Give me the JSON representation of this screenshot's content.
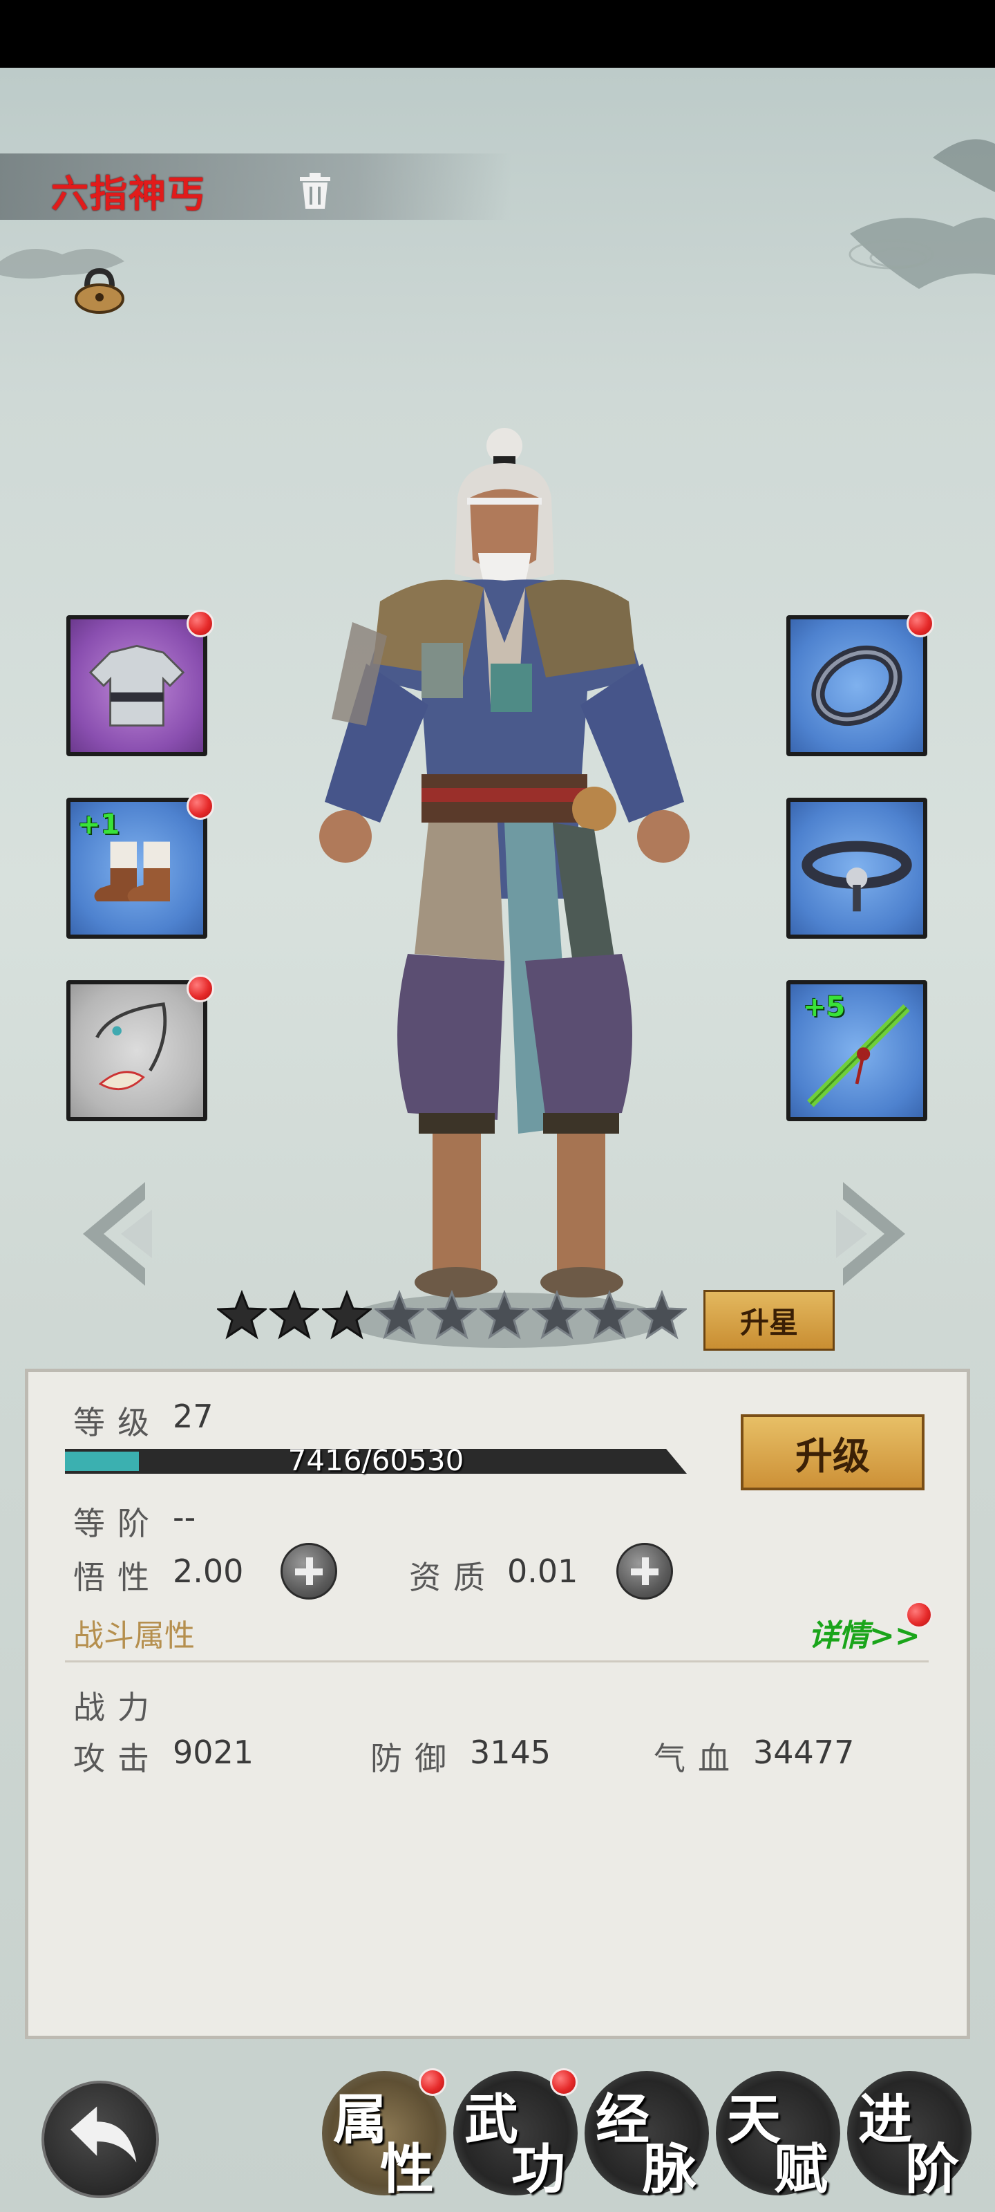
{
  "character": {
    "name": "六指神丐"
  },
  "equipment": {
    "left": [
      {
        "item": "robe",
        "has_notice": true,
        "enhance": ""
      },
      {
        "item": "boots",
        "has_notice": true,
        "enhance": "+1"
      },
      {
        "item": "fang-necklace",
        "has_notice": true,
        "enhance": ""
      }
    ],
    "right": [
      {
        "item": "ring",
        "has_notice": true,
        "enhance": ""
      },
      {
        "item": "belt",
        "has_notice": false,
        "enhance": ""
      },
      {
        "item": "bamboo-staff",
        "has_notice": false,
        "enhance": "+5"
      }
    ]
  },
  "stars": {
    "total": 9,
    "filled": 3
  },
  "star_up_label": "升星",
  "stats": {
    "level_label": "等级",
    "level_value": "27",
    "xp_text": "7416/60530",
    "xp_current": 7416,
    "xp_max": 60530,
    "level_up_label": "升级",
    "rank_label": "等阶",
    "rank_value": "--",
    "insight_label": "悟性",
    "insight_value": "2.00",
    "aptitude_label": "资质",
    "aptitude_value": "0.01",
    "battle_section_title": "战斗属性",
    "details_link": "详情>>",
    "power_label": "战力",
    "attack_label": "攻击",
    "attack_value": "9021",
    "defense_label": "防御",
    "defense_value": "3145",
    "hp_label": "气血",
    "hp_value": "34477"
  },
  "tabs": [
    {
      "c1": "属",
      "c2": "性",
      "active": true,
      "has_notice": true
    },
    {
      "c1": "武",
      "c2": "功",
      "active": false,
      "has_notice": true
    },
    {
      "c1": "经",
      "c2": "脉",
      "active": false,
      "has_notice": false
    },
    {
      "c1": "天",
      "c2": "赋",
      "active": false,
      "has_notice": false
    },
    {
      "c1": "进",
      "c2": "阶",
      "active": false,
      "has_notice": false
    }
  ],
  "colors": {
    "name_red": "#e11b1b",
    "xp_fill": "#3bb0b0",
    "enhance_green": "#39e239",
    "details_green": "#1aa51a"
  },
  "icons": [
    "trash-icon",
    "lock-icon",
    "back-arrow-icon",
    "chevron-left-icon",
    "chevron-right-icon",
    "star-icon",
    "plus-icon"
  ]
}
